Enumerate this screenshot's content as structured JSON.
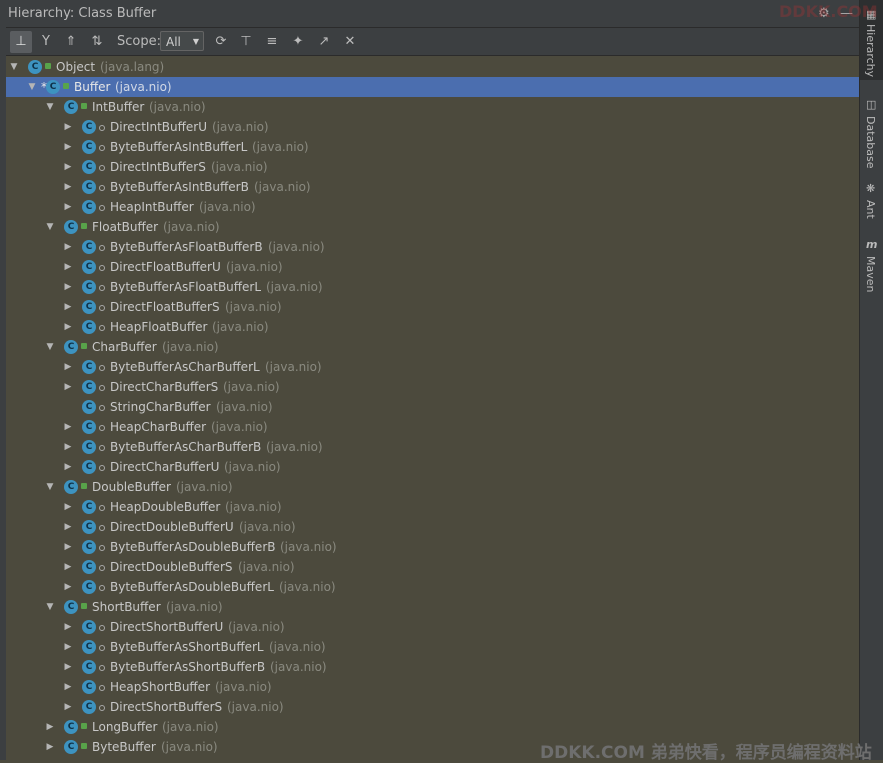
{
  "titlebar": {
    "title": "Hierarchy:  Class Buffer"
  },
  "toolbar": {
    "scope_label": "Scope:",
    "scope_value": "All",
    "icons": [
      "type-hierarchy-icon",
      "supertypes-hierarchy-icon",
      "subtypes-hierarchy-icon",
      "sort-alphabetically-icon",
      "refresh-icon",
      "scroll-to-source-icon",
      "expand-all-icon",
      "pin-icon",
      "export-icon",
      "close-icon"
    ]
  },
  "right_tabs": [
    {
      "label": "Hierarchy",
      "icon": "hierarchy-icon"
    },
    {
      "label": "Database",
      "icon": "database-icon"
    },
    {
      "label": "Ant",
      "icon": "ant-icon"
    },
    {
      "label": "Maven",
      "icon": "maven-icon"
    }
  ],
  "watermark": {
    "text": "DDKK.COM 弟弟快看，程序员编程资料站",
    "top_text": "DDKK.COM"
  },
  "tree": [
    {
      "name": "Object",
      "pkg": "(java.lang)",
      "level": 0,
      "arrow": "open",
      "marker": "lock"
    },
    {
      "name": "Buffer",
      "pkg": "(java.nio)",
      "level": 1,
      "arrow": "open",
      "marker": "lock",
      "selected": true,
      "star": true
    },
    {
      "name": "IntBuffer",
      "pkg": "(java.nio)",
      "level": 2,
      "arrow": "open",
      "marker": "lock"
    },
    {
      "name": "DirectIntBufferU",
      "pkg": "(java.nio)",
      "level": 3,
      "arrow": "closed",
      "marker": "dot"
    },
    {
      "name": "ByteBufferAsIntBufferL",
      "pkg": "(java.nio)",
      "level": 3,
      "arrow": "closed",
      "marker": "dot"
    },
    {
      "name": "DirectIntBufferS",
      "pkg": "(java.nio)",
      "level": 3,
      "arrow": "closed",
      "marker": "dot"
    },
    {
      "name": "ByteBufferAsIntBufferB",
      "pkg": "(java.nio)",
      "level": 3,
      "arrow": "closed",
      "marker": "dot"
    },
    {
      "name": "HeapIntBuffer",
      "pkg": "(java.nio)",
      "level": 3,
      "arrow": "closed",
      "marker": "dot"
    },
    {
      "name": "FloatBuffer",
      "pkg": "(java.nio)",
      "level": 2,
      "arrow": "open",
      "marker": "lock"
    },
    {
      "name": "ByteBufferAsFloatBufferB",
      "pkg": "(java.nio)",
      "level": 3,
      "arrow": "closed",
      "marker": "dot"
    },
    {
      "name": "DirectFloatBufferU",
      "pkg": "(java.nio)",
      "level": 3,
      "arrow": "closed",
      "marker": "dot"
    },
    {
      "name": "ByteBufferAsFloatBufferL",
      "pkg": "(java.nio)",
      "level": 3,
      "arrow": "closed",
      "marker": "dot"
    },
    {
      "name": "DirectFloatBufferS",
      "pkg": "(java.nio)",
      "level": 3,
      "arrow": "closed",
      "marker": "dot"
    },
    {
      "name": "HeapFloatBuffer",
      "pkg": "(java.nio)",
      "level": 3,
      "arrow": "closed",
      "marker": "dot"
    },
    {
      "name": "CharBuffer",
      "pkg": "(java.nio)",
      "level": 2,
      "arrow": "open",
      "marker": "lock"
    },
    {
      "name": "ByteBufferAsCharBufferL",
      "pkg": "(java.nio)",
      "level": 3,
      "arrow": "closed",
      "marker": "dot"
    },
    {
      "name": "DirectCharBufferS",
      "pkg": "(java.nio)",
      "level": 3,
      "arrow": "closed",
      "marker": "dot"
    },
    {
      "name": "StringCharBuffer",
      "pkg": "(java.nio)",
      "level": 3,
      "arrow": "none",
      "marker": "dot"
    },
    {
      "name": "HeapCharBuffer",
      "pkg": "(java.nio)",
      "level": 3,
      "arrow": "closed",
      "marker": "dot"
    },
    {
      "name": "ByteBufferAsCharBufferB",
      "pkg": "(java.nio)",
      "level": 3,
      "arrow": "closed",
      "marker": "dot"
    },
    {
      "name": "DirectCharBufferU",
      "pkg": "(java.nio)",
      "level": 3,
      "arrow": "closed",
      "marker": "dot"
    },
    {
      "name": "DoubleBuffer",
      "pkg": "(java.nio)",
      "level": 2,
      "arrow": "open",
      "marker": "lock"
    },
    {
      "name": "HeapDoubleBuffer",
      "pkg": "(java.nio)",
      "level": 3,
      "arrow": "closed",
      "marker": "dot"
    },
    {
      "name": "DirectDoubleBufferU",
      "pkg": "(java.nio)",
      "level": 3,
      "arrow": "closed",
      "marker": "dot"
    },
    {
      "name": "ByteBufferAsDoubleBufferB",
      "pkg": "(java.nio)",
      "level": 3,
      "arrow": "closed",
      "marker": "dot"
    },
    {
      "name": "DirectDoubleBufferS",
      "pkg": "(java.nio)",
      "level": 3,
      "arrow": "closed",
      "marker": "dot"
    },
    {
      "name": "ByteBufferAsDoubleBufferL",
      "pkg": "(java.nio)",
      "level": 3,
      "arrow": "closed",
      "marker": "dot"
    },
    {
      "name": "ShortBuffer",
      "pkg": "(java.nio)",
      "level": 2,
      "arrow": "open",
      "marker": "lock"
    },
    {
      "name": "DirectShortBufferU",
      "pkg": "(java.nio)",
      "level": 3,
      "arrow": "closed",
      "marker": "dot"
    },
    {
      "name": "ByteBufferAsShortBufferL",
      "pkg": "(java.nio)",
      "level": 3,
      "arrow": "closed",
      "marker": "dot"
    },
    {
      "name": "ByteBufferAsShortBufferB",
      "pkg": "(java.nio)",
      "level": 3,
      "arrow": "closed",
      "marker": "dot"
    },
    {
      "name": "HeapShortBuffer",
      "pkg": "(java.nio)",
      "level": 3,
      "arrow": "closed",
      "marker": "dot"
    },
    {
      "name": "DirectShortBufferS",
      "pkg": "(java.nio)",
      "level": 3,
      "arrow": "closed",
      "marker": "dot"
    },
    {
      "name": "LongBuffer",
      "pkg": "(java.nio)",
      "level": 2,
      "arrow": "closed",
      "marker": "lock"
    },
    {
      "name": "ByteBuffer",
      "pkg": "(java.nio)",
      "level": 2,
      "arrow": "closed",
      "marker": "lock"
    }
  ]
}
